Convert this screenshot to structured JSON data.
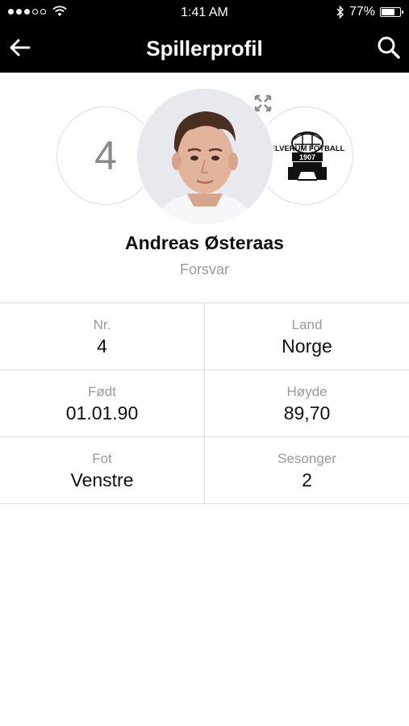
{
  "status_bar": {
    "time": "1:41 AM",
    "battery": "77%",
    "battery_level": 0.77,
    "signal_bars": 3,
    "signal_total": 5
  },
  "nav": {
    "title": "Spillerprofil",
    "back_icon": "arrow-left-icon",
    "search_icon": "search-icon"
  },
  "player": {
    "number": "4",
    "name": "Andreas Østeraas",
    "position": "Forsvar",
    "club_logo_text_top": "ELVERUM FOTBALL",
    "club_logo_year": "1907"
  },
  "stats": [
    {
      "left": {
        "label": "Nr.",
        "value": "4"
      },
      "right": {
        "label": "Land",
        "value": "Norge"
      }
    },
    {
      "left": {
        "label": "Født",
        "value": "01.01.90"
      },
      "right": {
        "label": "Høyde",
        "value": "89,70"
      }
    },
    {
      "left": {
        "label": "Fot",
        "value": "Venstre"
      },
      "right": {
        "label": "Sesonger",
        "value": "2"
      }
    }
  ],
  "colors": {
    "bar_background": "#000000",
    "divider": "#dddddd",
    "muted_text": "#9a9a9a"
  }
}
